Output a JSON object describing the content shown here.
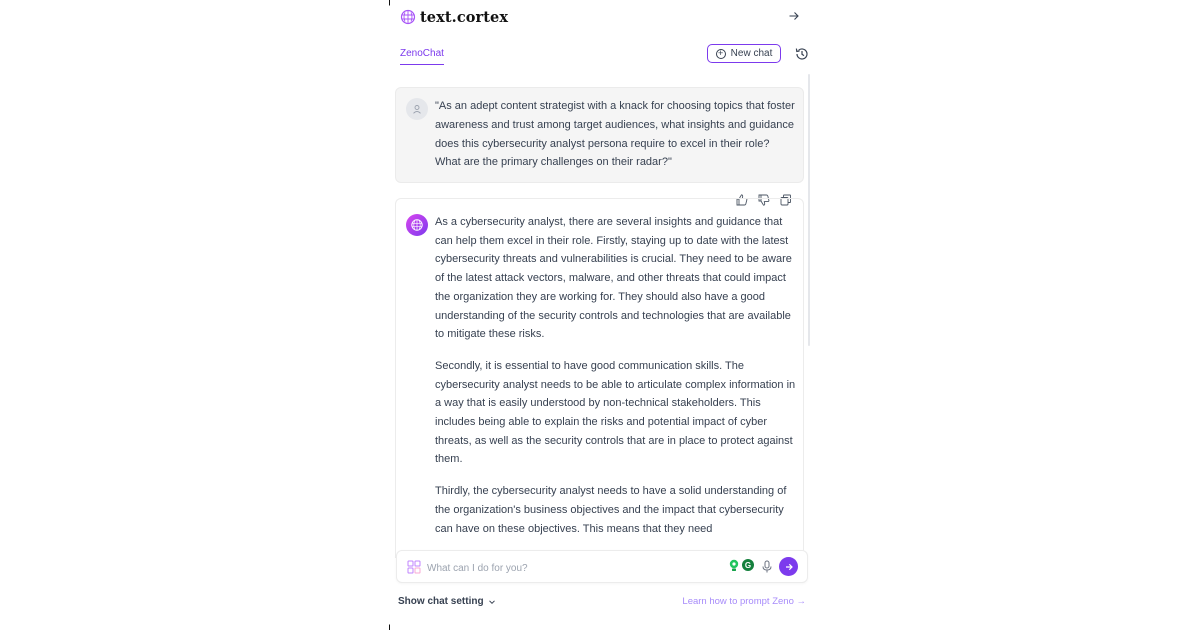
{
  "brand": {
    "name": "text.cortex"
  },
  "tabs": {
    "active_label": "ZenoChat"
  },
  "toolbar": {
    "new_chat_label": "New chat"
  },
  "conversation": {
    "user_message": "\"As an adept content strategist with a knack for choosing topics that foster awareness and trust among target audiences, what insights and guidance does this cybersecurity analyst persona require to excel in their role? What are the primary challenges on their radar?\"",
    "assistant_paragraphs": [
      "As a cybersecurity analyst, there are several insights and guidance that can help them excel in their role. Firstly, staying up to date with the latest cybersecurity threats and vulnerabilities is crucial. They need to be aware of the latest attack vectors, malware, and other threats that could impact the organization they are working for. They should also have a good understanding of the security controls and technologies that are available to mitigate these risks.",
      "Secondly, it is essential to have good communication skills. The cybersecurity analyst needs to be able to articulate complex information in a way that is easily understood by non-technical stakeholders. This includes being able to explain the risks and potential impact of cyber threats, as well as the security controls that are in place to protect against them.",
      "Thirdly, the cybersecurity analyst needs to have a solid understanding of the organization's business objectives and the impact that cybersecurity can have on these objectives. This means that they need"
    ]
  },
  "input": {
    "placeholder": "What can I do for you?",
    "value": ""
  },
  "footer": {
    "show_setting_label": "Show chat setting",
    "learn_link": "Learn how to prompt Zeno →"
  },
  "colors": {
    "accent": "#7c3aed",
    "grammarly_green": "#15803d",
    "link": "#a78bfa"
  },
  "icons": [
    "brain-logo-icon",
    "arrow-right-icon",
    "plus-circle-icon",
    "history-icon",
    "user-icon",
    "thumbs-up-icon",
    "thumbs-down-icon",
    "copy-icon",
    "ai-avatar-icon",
    "grid-icon",
    "lightbulb-icon",
    "grammarly-icon",
    "microphone-icon",
    "send-icon",
    "chevron-down-icon"
  ]
}
